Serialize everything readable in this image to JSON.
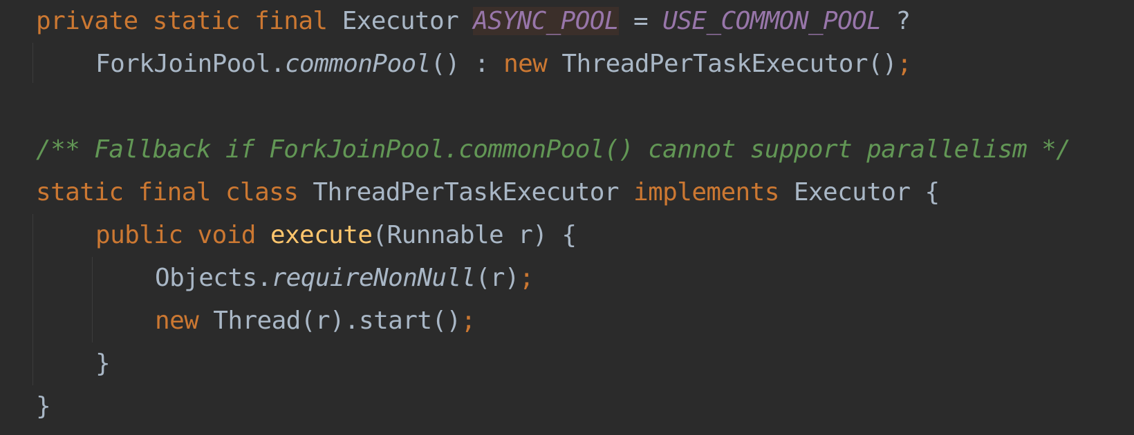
{
  "editor": {
    "background": "#2b2b2b",
    "colors": {
      "keyword": "#cc7832",
      "field": "#9876aa",
      "comment": "#629755",
      "method": "#ffc66d",
      "text": "#a9b7c6",
      "highlight": "#3b2f2a"
    },
    "line1": {
      "kw": "private static final ",
      "type": "Executor ",
      "field": "ASYNC_POOL",
      "eq": " = ",
      "field2": "USE_COMMON_POOL",
      "q": " ?"
    },
    "line2": {
      "cls": "ForkJoinPool.",
      "call": "commonPool",
      "rest": "() : ",
      "kw": "new ",
      "ctor": "ThreadPerTaskExecutor()",
      "semi": ";"
    },
    "line3": {
      "text": ""
    },
    "line4": {
      "comment": "/** Fallback if ForkJoinPool.commonPool() cannot support parallelism */"
    },
    "line5": {
      "kw": "static final class ",
      "name": "ThreadPerTaskExecutor ",
      "kw2": "implements ",
      "iface": "Executor {"
    },
    "line6": {
      "kw": "public void ",
      "method": "execute",
      "rest": "(Runnable r) {"
    },
    "line7": {
      "cls": "Objects.",
      "call": "requireNonNull",
      "rest": "(r)",
      "semi": ";"
    },
    "line8": {
      "kw": "new ",
      "rest": "Thread(r).start()",
      "semi": ";"
    },
    "line9": {
      "brace": "}"
    },
    "line10": {
      "brace": "}"
    }
  }
}
